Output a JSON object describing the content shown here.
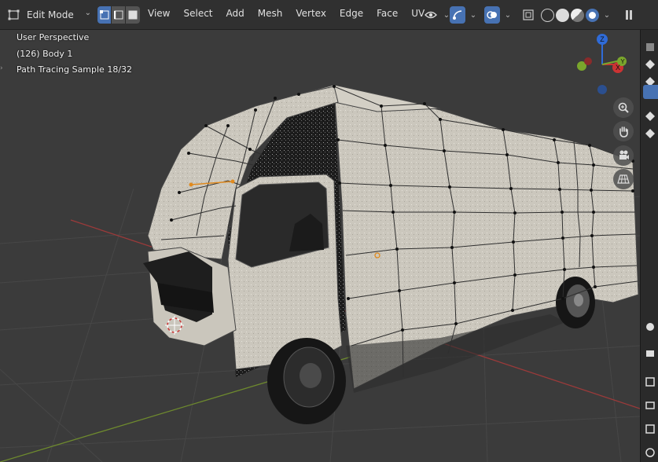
{
  "header": {
    "mode_label": "Edit Mode",
    "menus": [
      "View",
      "Select",
      "Add",
      "Mesh",
      "Vertex",
      "Edge",
      "Face",
      "UV"
    ]
  },
  "viewport": {
    "perspective_label": "User Perspective",
    "object_label": "(126) Body 1",
    "render_status": "Path Tracing Sample 18/32"
  },
  "gizmo": {
    "x_label": "X",
    "y_label": "Y",
    "z_label": "Z"
  },
  "colors": {
    "accent": "#4772b3",
    "background": "#3b3b3b",
    "grid": "#474747",
    "x_axis": "#9a3a3a",
    "y_axis": "#6e8a2e",
    "body": "#cbc7bd",
    "selected_vertex": "#e08a1e"
  },
  "icons": {
    "mode": "edit-mode-icon",
    "select_modes": [
      "vertex-select-icon",
      "edge-select-icon",
      "face-select-icon"
    ],
    "viewport_tools": [
      "visibility-icon",
      "gizmo-icon",
      "overlay-icon",
      "xray-icon"
    ],
    "shading": [
      "wireframe-icon",
      "solid-icon",
      "material-icon",
      "rendered-icon"
    ],
    "navigation": [
      "zoom-icon",
      "pan-hand-icon",
      "camera-icon",
      "grid-icon"
    ]
  }
}
